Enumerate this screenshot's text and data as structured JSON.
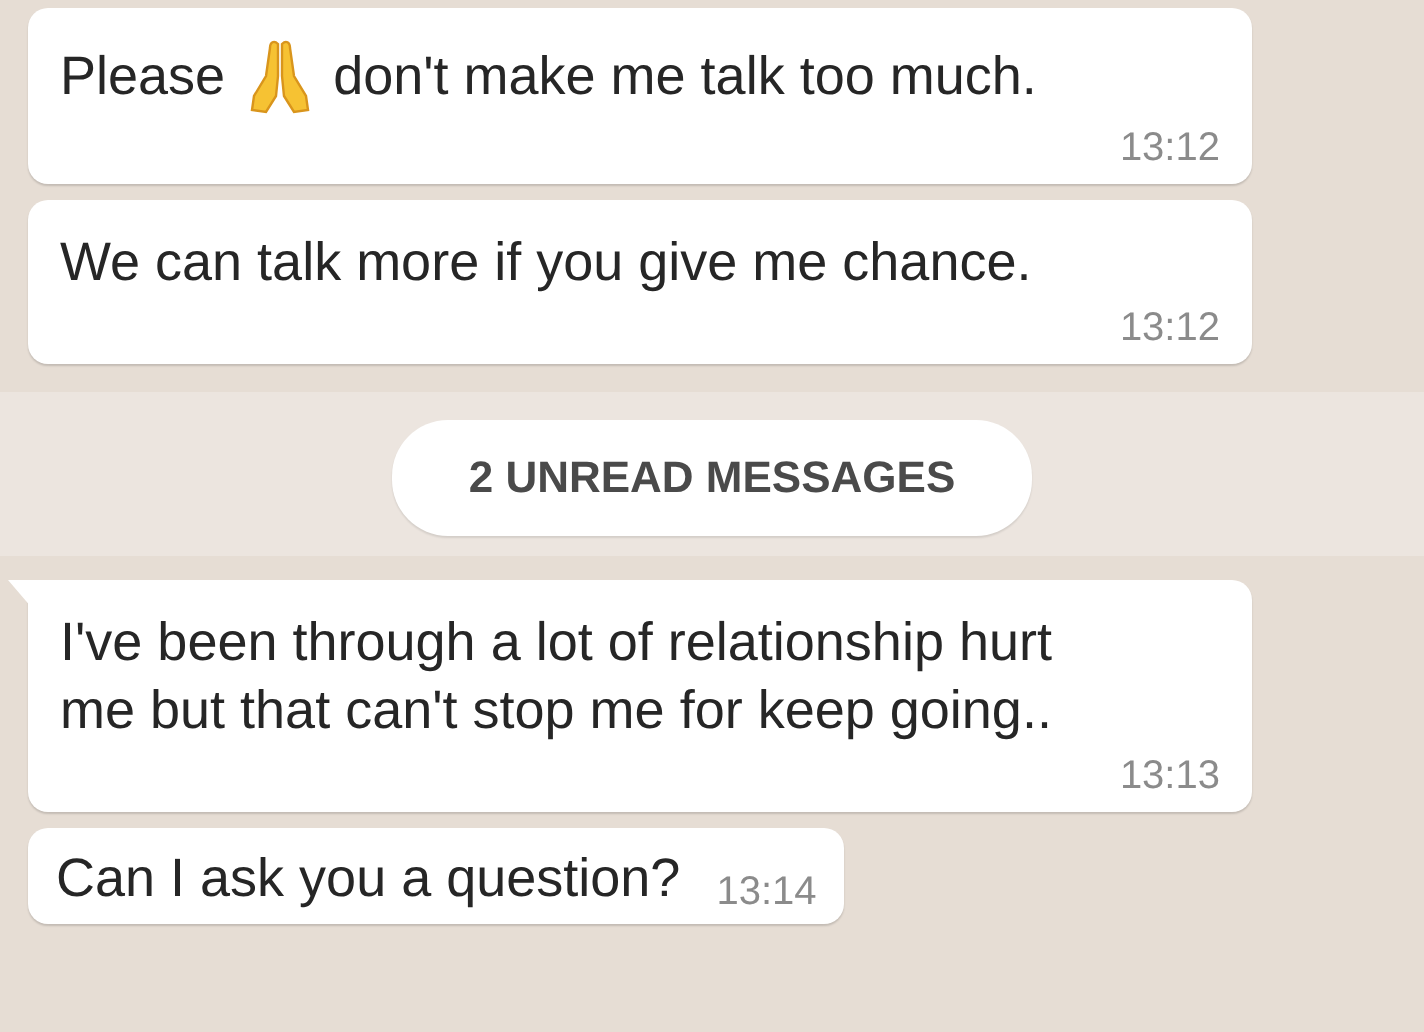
{
  "messages": [
    {
      "kind": "block",
      "tail": false,
      "segments": [
        {
          "kind": "text",
          "text": "Please"
        },
        {
          "kind": "emoji"
        },
        {
          "kind": "text",
          "text": "don't make me talk too much."
        }
      ],
      "time": "13:12"
    },
    {
      "kind": "block",
      "tail": false,
      "segments": [
        {
          "kind": "text",
          "text": "We can talk more if you give me chance."
        }
      ],
      "time": "13:12"
    },
    {
      "kind": "divider",
      "label": "2 UNREAD MESSAGES"
    },
    {
      "kind": "block",
      "tail": true,
      "segments": [
        {
          "kind": "text",
          "text": "I've been through a lot of relationship hurt me but that can't stop me for keep going.."
        }
      ],
      "time": "13:13"
    },
    {
      "kind": "compact",
      "tail": false,
      "segments": [
        {
          "kind": "text",
          "text": "Can I ask you a question?"
        }
      ],
      "time": "13:14"
    }
  ]
}
